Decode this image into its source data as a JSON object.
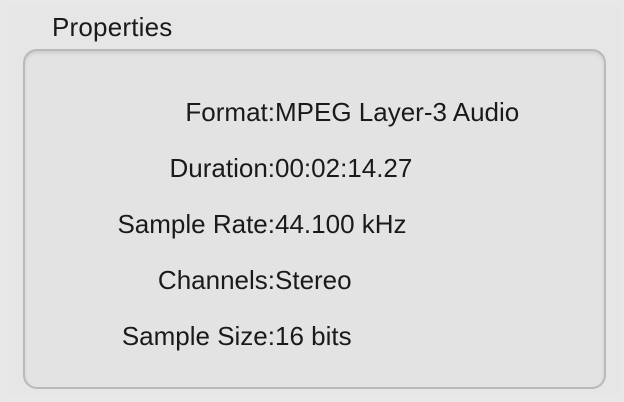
{
  "properties": {
    "title": "Properties",
    "rows": [
      {
        "label": "Format:",
        "value": "MPEG Layer-3 Audio"
      },
      {
        "label": "Duration:",
        "value": "00:02:14.27"
      },
      {
        "label": "Sample Rate:",
        "value": "44.100 kHz"
      },
      {
        "label": "Channels:",
        "value": "Stereo"
      },
      {
        "label": "Sample Size:",
        "value": "16 bits"
      }
    ]
  }
}
